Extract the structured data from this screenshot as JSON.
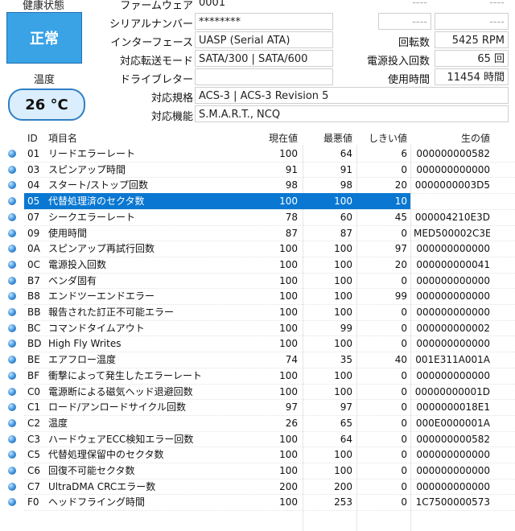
{
  "status": {
    "health_label": "健康状態",
    "health_value": "正常",
    "temp_label": "温度",
    "temp_value": "26 °C"
  },
  "info": {
    "firmware_label": "ファームウェア",
    "firmware_value": "0001",
    "serial_label": "シリアルナンバー",
    "serial_value": "********",
    "interface_label": "インターフェース",
    "interface_value": "UASP (Serial ATA)",
    "transfer_label": "対応転送モード",
    "transfer_value": "SATA/300 | SATA/600",
    "drive_letter_label": "ドライブレター",
    "drive_letter_value": "",
    "standard_label": "対応規格",
    "standard_value": "ACS-3 | ACS-3 Revision 5",
    "features_label": "対応機能",
    "features_value": "S.M.A.R.T., NCQ",
    "right_blank1": "----",
    "right_blank2": "----",
    "right_blank3": "----",
    "right_blank4": "----",
    "rpm_label": "回転数",
    "rpm_value": "5425 RPM",
    "power_count_label": "電源投入回数",
    "power_count_value": "65 回",
    "power_hours_label": "使用時間",
    "power_hours_value": "11454 時間"
  },
  "table": {
    "headers": {
      "id": "ID",
      "name": "項目名",
      "current": "現在値",
      "worst": "最悪値",
      "threshold": "しきい値",
      "raw": "生の値"
    },
    "rows": [
      {
        "id": "01",
        "name": "リードエラーレート",
        "current": "100",
        "worst": "64",
        "threshold": "6",
        "raw": "000000000582"
      },
      {
        "id": "03",
        "name": "スピンアップ時間",
        "current": "91",
        "worst": "91",
        "threshold": "0",
        "raw": "000000000000"
      },
      {
        "id": "04",
        "name": "スタート/ストップ回数",
        "current": "98",
        "worst": "98",
        "threshold": "20",
        "raw": "0000000003D5"
      },
      {
        "id": "05",
        "name": "代替処理済のセクタ数",
        "current": "100",
        "worst": "100",
        "threshold": "10",
        "raw": "000000000000"
      },
      {
        "id": "07",
        "name": "シークエラーレート",
        "current": "78",
        "worst": "60",
        "threshold": "45",
        "raw": "000004210E3D"
      },
      {
        "id": "09",
        "name": "使用時間",
        "current": "87",
        "worst": "87",
        "threshold": "0",
        "raw": "MED500002C3E"
      },
      {
        "id": "0A",
        "name": "スピンアップ再試行回数",
        "current": "100",
        "worst": "100",
        "threshold": "97",
        "raw": "000000000000"
      },
      {
        "id": "0C",
        "name": "電源投入回数",
        "current": "100",
        "worst": "100",
        "threshold": "20",
        "raw": "000000000041"
      },
      {
        "id": "B7",
        "name": "ベンダ固有",
        "current": "100",
        "worst": "100",
        "threshold": "0",
        "raw": "000000000000"
      },
      {
        "id": "B8",
        "name": "エンドツーエンドエラー",
        "current": "100",
        "worst": "100",
        "threshold": "99",
        "raw": "000000000000"
      },
      {
        "id": "BB",
        "name": "報告された訂正不可能エラー",
        "current": "100",
        "worst": "100",
        "threshold": "0",
        "raw": "000000000000"
      },
      {
        "id": "BC",
        "name": "コマンドタイムアウト",
        "current": "100",
        "worst": "99",
        "threshold": "0",
        "raw": "000000000002"
      },
      {
        "id": "BD",
        "name": "High Fly Writes",
        "current": "100",
        "worst": "100",
        "threshold": "0",
        "raw": "000000000000"
      },
      {
        "id": "BE",
        "name": "エアフロー温度",
        "current": "74",
        "worst": "35",
        "threshold": "40",
        "raw": "001E311A001A"
      },
      {
        "id": "BF",
        "name": "衝撃によって発生したエラーレート",
        "current": "100",
        "worst": "100",
        "threshold": "0",
        "raw": "000000000000"
      },
      {
        "id": "C0",
        "name": "電源断による磁気ヘッド退避回数",
        "current": "100",
        "worst": "100",
        "threshold": "0",
        "raw": "00000000001D"
      },
      {
        "id": "C1",
        "name": "ロード/アンロードサイクル回数",
        "current": "97",
        "worst": "97",
        "threshold": "0",
        "raw": "0000000018E1"
      },
      {
        "id": "C2",
        "name": "温度",
        "current": "26",
        "worst": "65",
        "threshold": "0",
        "raw": "000E0000001A"
      },
      {
        "id": "C3",
        "name": "ハードウェアECC検知エラー回数",
        "current": "100",
        "worst": "64",
        "threshold": "0",
        "raw": "000000000582"
      },
      {
        "id": "C5",
        "name": "代替処理保留中のセクタ数",
        "current": "100",
        "worst": "100",
        "threshold": "0",
        "raw": "000000000000"
      },
      {
        "id": "C6",
        "name": "回復不可能セクタ数",
        "current": "100",
        "worst": "100",
        "threshold": "0",
        "raw": "000000000000"
      },
      {
        "id": "C7",
        "name": "UltraDMA CRCエラー数",
        "current": "200",
        "worst": "200",
        "threshold": "0",
        "raw": "000000000000"
      },
      {
        "id": "F0",
        "name": "ヘッドフライング時間",
        "current": "100",
        "worst": "253",
        "threshold": "0",
        "raw": "1C7500000573"
      }
    ],
    "selected_index": 3
  },
  "colors": {
    "health": "#3aa3e6",
    "selection": "#0a78d2",
    "temp_bg": "#dbeefd"
  }
}
